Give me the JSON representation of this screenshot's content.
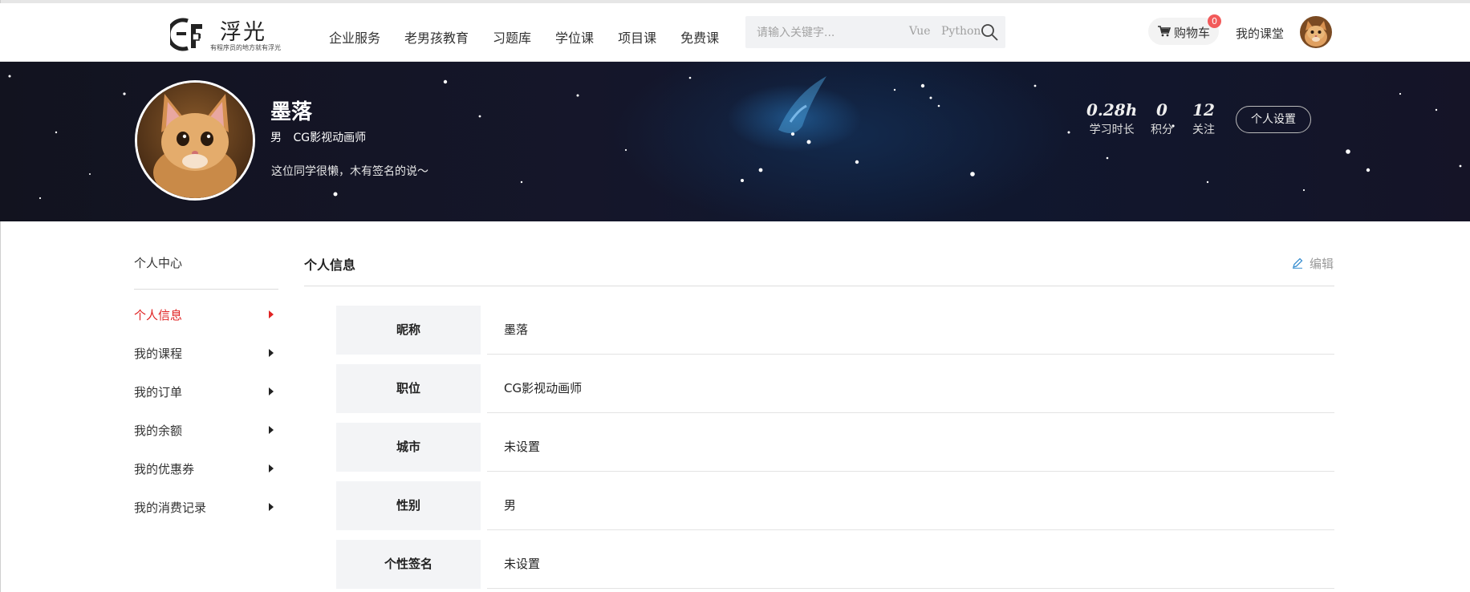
{
  "header": {
    "logo_title": "浮光",
    "logo_slogan": "有程序员的地方就有浮光",
    "nav": [
      "企业服务",
      "老男孩教育",
      "习题库",
      "学位课",
      "项目课",
      "免费课"
    ],
    "search": {
      "placeholder": "请输入关键字...",
      "hot_tags": [
        "Vue",
        "Python"
      ]
    },
    "cart": {
      "label": "购物车",
      "count": "0"
    },
    "my_class": "我的课堂"
  },
  "profile": {
    "name": "墨落",
    "gender": "男",
    "position": "CG影视动画师",
    "signature": "这位同学很懒，木有签名的说～",
    "stats": [
      {
        "value": "0.28h",
        "label": "学习时长"
      },
      {
        "value": "0",
        "label": "积分"
      },
      {
        "value": "12",
        "label": "关注"
      }
    ],
    "settings_button": "个人设置"
  },
  "sidebar": {
    "title": "个人中心",
    "items": [
      {
        "label": "个人信息",
        "active": true
      },
      {
        "label": "我的课程",
        "active": false
      },
      {
        "label": "我的订单",
        "active": false
      },
      {
        "label": "我的余额",
        "active": false
      },
      {
        "label": "我的优惠券",
        "active": false
      },
      {
        "label": "我的消费记录",
        "active": false
      }
    ]
  },
  "main": {
    "title": "个人信息",
    "edit_label": "编辑",
    "rows": [
      {
        "key": "昵称",
        "value": "墨落"
      },
      {
        "key": "职位",
        "value": "CG影视动画师"
      },
      {
        "key": "城市",
        "value": "未设置"
      },
      {
        "key": "性别",
        "value": "男"
      },
      {
        "key": "个性签名",
        "value": "未设置"
      }
    ]
  },
  "colors": {
    "accent_red": "#e02424",
    "badge": "#f25a5a",
    "banner_bg": "#14152a"
  },
  "icons": [
    "logo-mark-icon",
    "search-icon",
    "cart-icon",
    "chevron-right-icon",
    "edit-pencil-icon",
    "cat-avatar"
  ]
}
